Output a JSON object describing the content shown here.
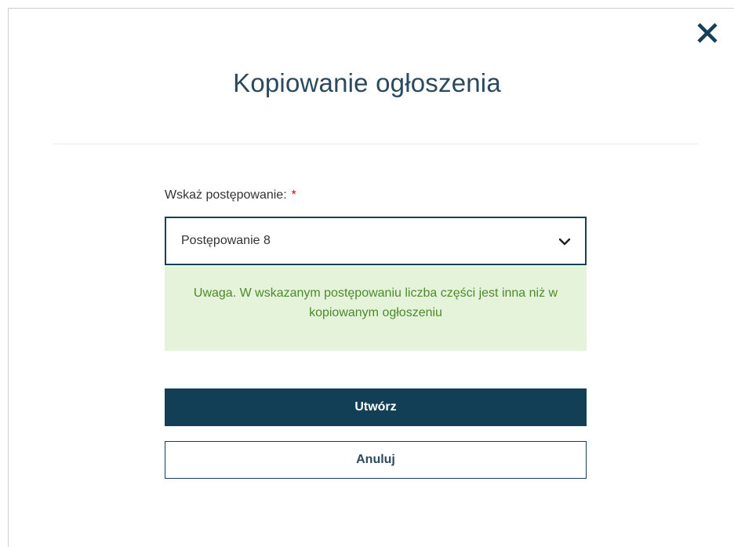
{
  "dialog": {
    "title": "Kopiowanie ogłoszenia",
    "close_icon": "close-icon"
  },
  "form": {
    "proceeding_label": "Wskaż postępowanie:",
    "required_marker": "*",
    "proceeding_selected": "Postępowanie 8",
    "dropdown_icon": "chevron-down-icon"
  },
  "alert": {
    "message": "Uwaga. W wskazanym postępowaniu liczba części jest inna niż w kopiowanym ogłoszeniu"
  },
  "actions": {
    "create_label": "Utwórz",
    "cancel_label": "Anuluj"
  },
  "colors": {
    "primary": "#123f56",
    "required": "#d0021b",
    "alert_bg": "#e5f3da",
    "alert_text": "#4e8a2a"
  }
}
